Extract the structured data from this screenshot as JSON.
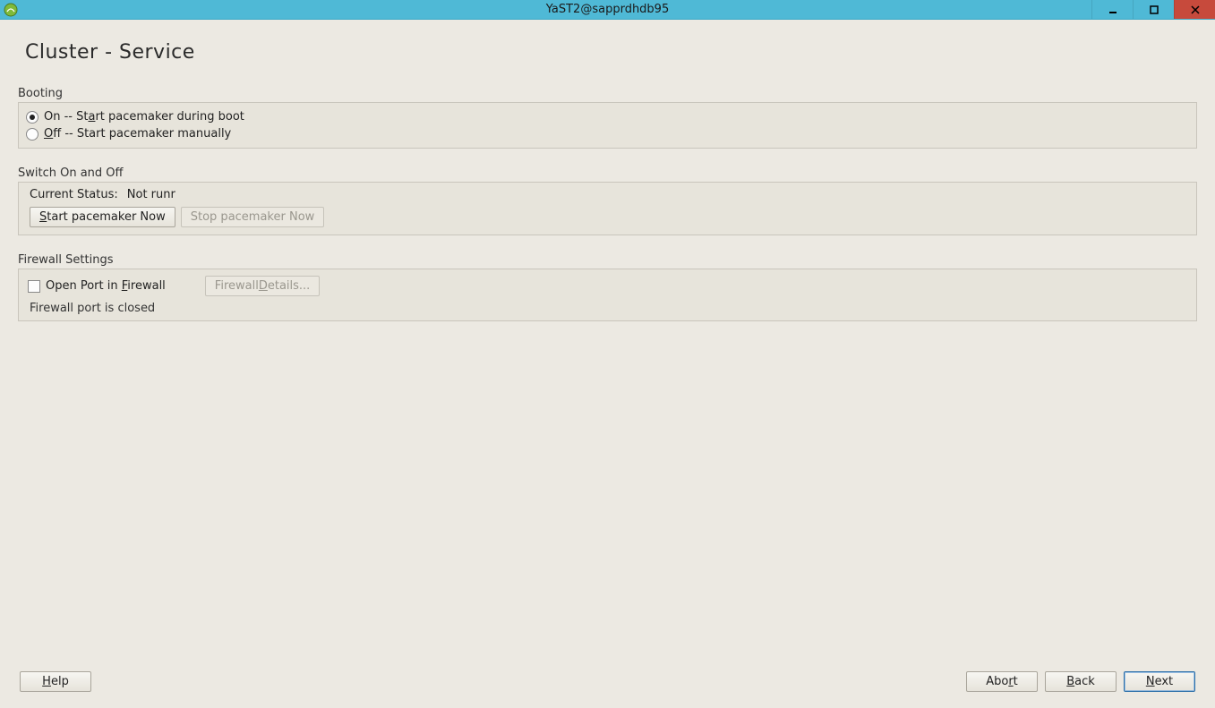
{
  "window": {
    "title": "YaST2@sapprdhdb95"
  },
  "page": {
    "title": "Cluster - Service"
  },
  "booting": {
    "label": "Booting",
    "on_prefix": "On -- St",
    "on_u": "a",
    "on_suffix": "rt pacemaker during boot",
    "off_u": "O",
    "off_suffix": "ff -- Start pacemaker manually"
  },
  "switch": {
    "label": "Switch On and Off",
    "status_label": "Current Status:",
    "status_value": "Not runr",
    "start_u": "S",
    "start_rest": "tart pacemaker Now",
    "stop": "Stop pacemaker Now"
  },
  "firewall": {
    "label": "Firewall Settings",
    "open_prefix": "Open Port in ",
    "open_u": "F",
    "open_suffix": "irewall",
    "details_prefix": "Firewall ",
    "details_u": "D",
    "details_suffix": "etails...",
    "status": "Firewall port is closed"
  },
  "footer": {
    "help_u": "H",
    "help_rest": "elp",
    "abort_prefix": "Abo",
    "abort_u": "r",
    "abort_suffix": "t",
    "back_u": "B",
    "back_rest": "ack",
    "next_u": "N",
    "next_rest": "ext"
  }
}
